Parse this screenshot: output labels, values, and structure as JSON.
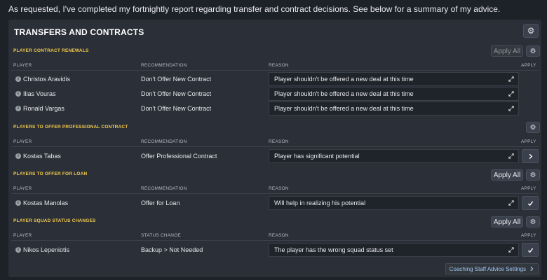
{
  "intro": "As requested, I've completed my fortnightly report regarding transfer and contract decisions. See below for a summary of my advice.",
  "panel": {
    "title": "TRANSFERS AND CONTRACTS"
  },
  "columns": {
    "player": "PLAYER",
    "recommendation": "RECOMMENDATION",
    "status_change": "STATUS CHANGE",
    "reason": "REASON",
    "apply": "APPLY"
  },
  "sections": {
    "renewals": {
      "title": "PLAYER CONTRACT RENEWALS",
      "apply_all": "Apply All",
      "rows": [
        {
          "player": "Christos Aravidis",
          "recommendation": "Don't Offer New Contract",
          "reason": "Player shouldn't be offered a new deal at this time"
        },
        {
          "player": "Ilias Vouras",
          "recommendation": "Don't Offer New Contract",
          "reason": "Player shouldn't be offered a new deal at this time"
        },
        {
          "player": "Ronald Vargas",
          "recommendation": "Don't Offer New Contract",
          "reason": "Player shouldn't be offered a new deal at this time"
        }
      ]
    },
    "professional": {
      "title": "PLAYERS TO OFFER PROFESSIONAL CONTRACT",
      "rows": [
        {
          "player": "Kostas Tabas",
          "recommendation": "Offer Professional Contract",
          "reason": "Player has significant potential",
          "apply_icon": "chevron-right"
        }
      ]
    },
    "loan": {
      "title": "PLAYERS TO OFFER FOR LOAN",
      "apply_all": "Apply All",
      "rows": [
        {
          "player": "Kostas Manolas",
          "recommendation": "Offer for Loan",
          "reason": "Will help in realizing his potential",
          "apply_icon": "check"
        }
      ]
    },
    "squad": {
      "title": "PLAYER SQUAD STATUS CHANGES",
      "apply_all": "Apply All",
      "rows": [
        {
          "player": "Nikos Lepeniotis",
          "recommendation": "Backup > Not Needed",
          "reason": "The player has the wrong squad status set",
          "apply_icon": "check"
        }
      ]
    }
  },
  "footer": {
    "link": "Coaching Staff Advice Settings"
  }
}
